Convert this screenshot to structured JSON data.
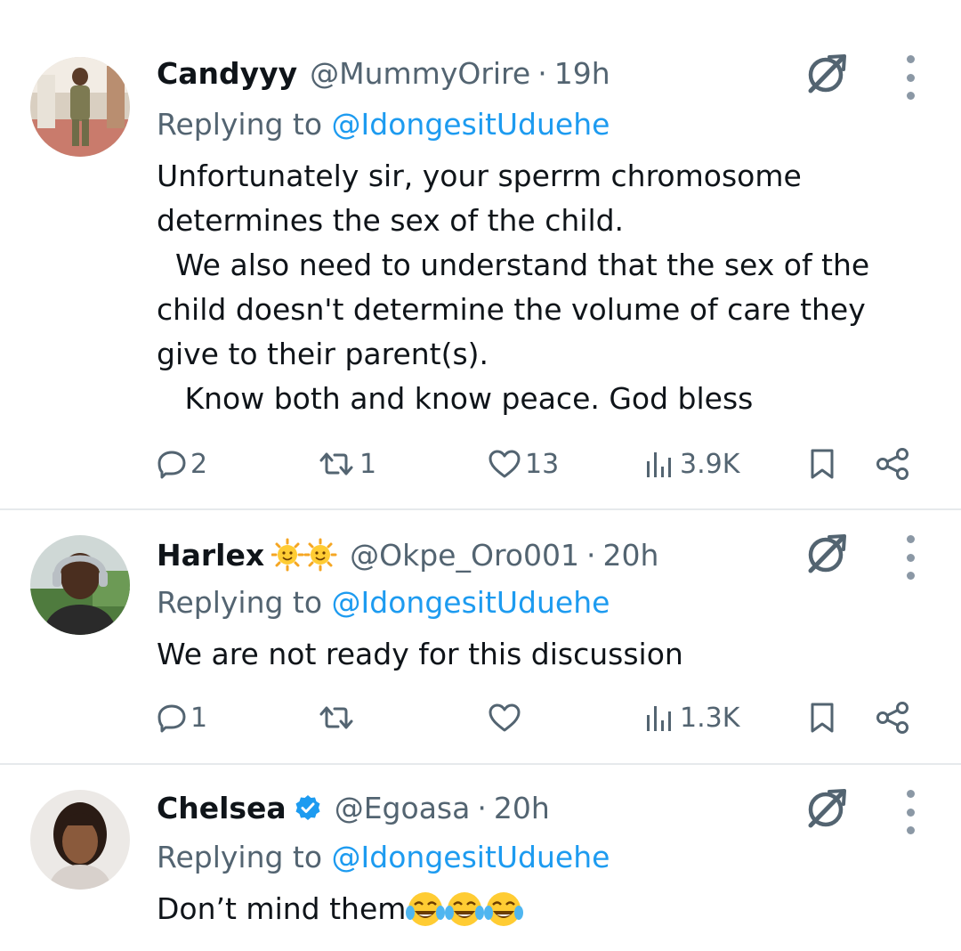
{
  "tweets": [
    {
      "name": "Candyyy",
      "handle": "@MummyOrire",
      "separator": "·",
      "time": "19h",
      "replying_prefix": "Replying to ",
      "replying_to": "@IdongesitUduehe",
      "text": "Unfortunately sir, your sperrm chromosome\ndetermines the sex of the child.\n  We also need to understand that the sex of the\nchild doesn't determine the volume of care they\ngive to their parent(s).\n   Know both and know peace. God bless",
      "replies": "2",
      "reposts": "1",
      "likes": "13",
      "views": "3.9K"
    },
    {
      "name": "Harlex",
      "name_emoji": "sun-with-face-emoji x2",
      "handle": "@Okpe_Oro001",
      "separator": "·",
      "time": "20h",
      "replying_prefix": "Replying to ",
      "replying_to": "@IdongesitUduehe",
      "text": "We are not ready for this discussion",
      "replies": "1",
      "reposts": "",
      "likes": "",
      "views": "1.3K"
    },
    {
      "name": "Chelsea",
      "verified": true,
      "handle": "@Egoasa",
      "separator": "·",
      "time": "20h",
      "replying_prefix": "Replying to ",
      "replying_to": "@IdongesitUduehe",
      "text": "Don’t mind them",
      "text_emoji": "face-with-tears-of-joy-emoji x3"
    }
  ],
  "icons": [
    "reply-icon",
    "repost-icon",
    "like-icon",
    "views-icon",
    "bookmark-icon",
    "share-icon",
    "grok-icon",
    "more-icon",
    "verified-badge-icon"
  ],
  "colors": {
    "text": "#0f1419",
    "secondary": "#536471",
    "link": "#1d9bf0",
    "verified": "#1d9bf0",
    "divider": "#e6e9ec"
  }
}
